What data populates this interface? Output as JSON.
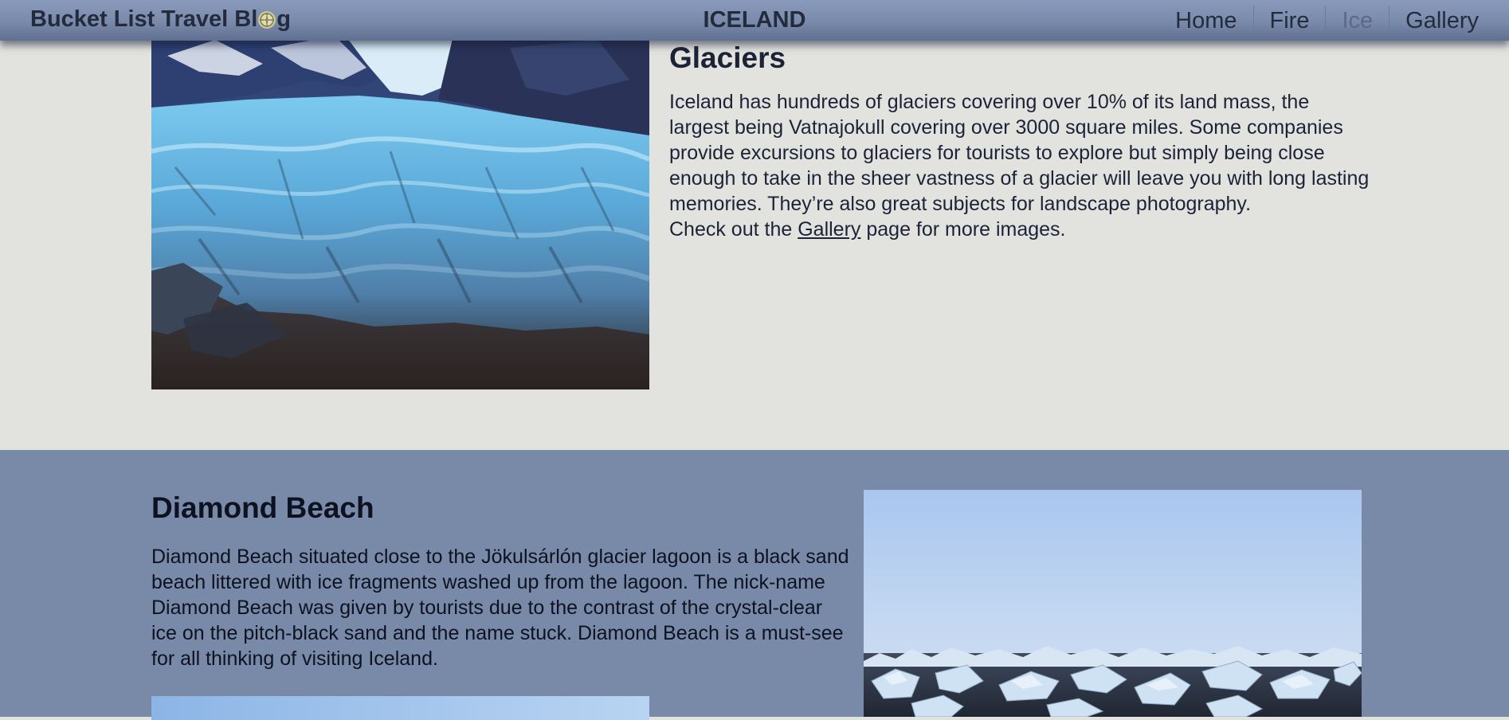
{
  "header": {
    "brand_prefix": "Bucket List Travel Bl",
    "brand_suffix": "g",
    "page_title": "ICELAND",
    "nav": [
      {
        "label": "Home",
        "active": false
      },
      {
        "label": "Fire",
        "active": false
      },
      {
        "label": "Ice",
        "active": true
      },
      {
        "label": "Gallery",
        "active": false
      }
    ]
  },
  "glaciers": {
    "heading": "Glaciers",
    "body": "Iceland has hundreds of glaciers covering over 10% of its land mass, the largest being Vatnajokull covering over 3000 square miles. Some companies provide excursions to glaciers for tourists to explore but simply being close enough to take in the sheer vastness of a glacier will leave you with long lasting memories. They’re also great subjects for landscape photography.",
    "more_prefix": "Check out the ",
    "more_link": "Gallery",
    "more_suffix": " page for more images."
  },
  "diamond_beach": {
    "heading": "Diamond Beach",
    "body": "Diamond Beach situated close to the Jökulsárlón glacier lagoon is a black sand beach littered with ice fragments washed up from the lagoon. The nick-name Diamond Beach was given by tourists due to the contrast of the crystal-clear ice on the pitch-black sand and the name stuck. Diamond Beach is a must-see for all thinking of visiting Iceland."
  },
  "colors": {
    "header_bg": "#7a8aab",
    "page_bg": "#e2e2de",
    "section_alt_bg": "#7989a8",
    "text_dark": "#1c2336",
    "nav_active": "#5a6a88"
  },
  "icons": {
    "brand_icon": "compass-icon"
  }
}
